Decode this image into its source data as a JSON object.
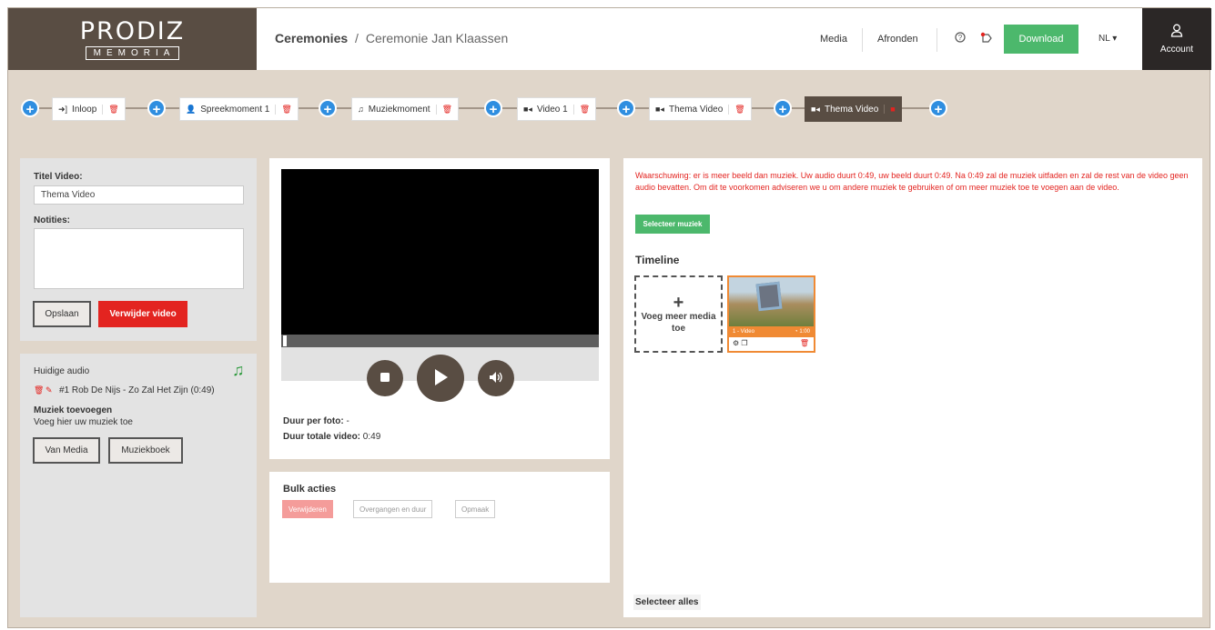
{
  "header": {
    "logo_main": "PRODIZ",
    "logo_sub": "MEMORIA",
    "breadcrumb_root": "Ceremonies",
    "breadcrumb_sep": "/",
    "breadcrumb_current": "Ceremonie Jan Klaassen",
    "nav_media": "Media",
    "nav_afronden": "Afronden",
    "download_label": "Download",
    "language": "NL",
    "account_label": "Account",
    "icons": [
      "help-icon",
      "notification-icon",
      "user-icon"
    ]
  },
  "steps": [
    {
      "label": "Inloop",
      "icon": "sign-in-icon"
    },
    {
      "label": "Spreekmoment 1",
      "icon": "person-icon"
    },
    {
      "label": "Muziekmoment",
      "icon": "music-icon"
    },
    {
      "label": "Video 1",
      "icon": "video-icon"
    },
    {
      "label": "Thema Video",
      "icon": "video-icon"
    },
    {
      "label": "Thema Video",
      "icon": "video-icon",
      "active": true
    }
  ],
  "video_form": {
    "title_label": "Titel Video:",
    "title_value": "Thema Video",
    "notes_label": "Notities:",
    "notes_value": "",
    "save_label": "Opslaan",
    "delete_label": "Verwijder video"
  },
  "audio": {
    "current_label": "Huidige audio",
    "track": "#1 Rob De Nijs - Zo Zal Het Zijn (0:49)",
    "add_title": "Muziek toevoegen",
    "add_hint": "Voeg hier uw muziek toe",
    "from_media_label": "Van Media",
    "music_book_label": "Muziekboek"
  },
  "player": {
    "duration_photo_label": "Duur per foto:",
    "duration_photo_value": "-",
    "duration_total_label": "Duur totale video:",
    "duration_total_value": "0:49"
  },
  "bulk": {
    "title": "Bulk acties",
    "delete_label": "Verwijderen",
    "transitions_label": "Overgangen en duur",
    "layout_label": "Opmaak"
  },
  "timeline": {
    "warning": "Waarschuwing: er is meer beeld dan muziek. Uw audio duurt 0:49, uw beeld duurt 0:49. Na 0:49 zal de muziek uitfaden en zal de rest van de video geen audio bevatten. Om dit te voorkomen adviseren we u om andere muziek te gebruiken of om meer muziek toe te voegen aan de video.",
    "select_music_label": "Selecteer muziek",
    "title": "Timeline",
    "add_media_plus": "+",
    "add_media_label": "Voeg meer media toe",
    "media_items": [
      {
        "label": "1 - Video",
        "duration": "1:00"
      }
    ],
    "select_all_label": "Selecteer alles"
  },
  "colors": {
    "brand_brown": "#594d43",
    "background": "#e0d6ca",
    "green": "#4cb86c",
    "red": "#e32420",
    "blue": "#2f8ee0",
    "orange": "#f08a34"
  }
}
